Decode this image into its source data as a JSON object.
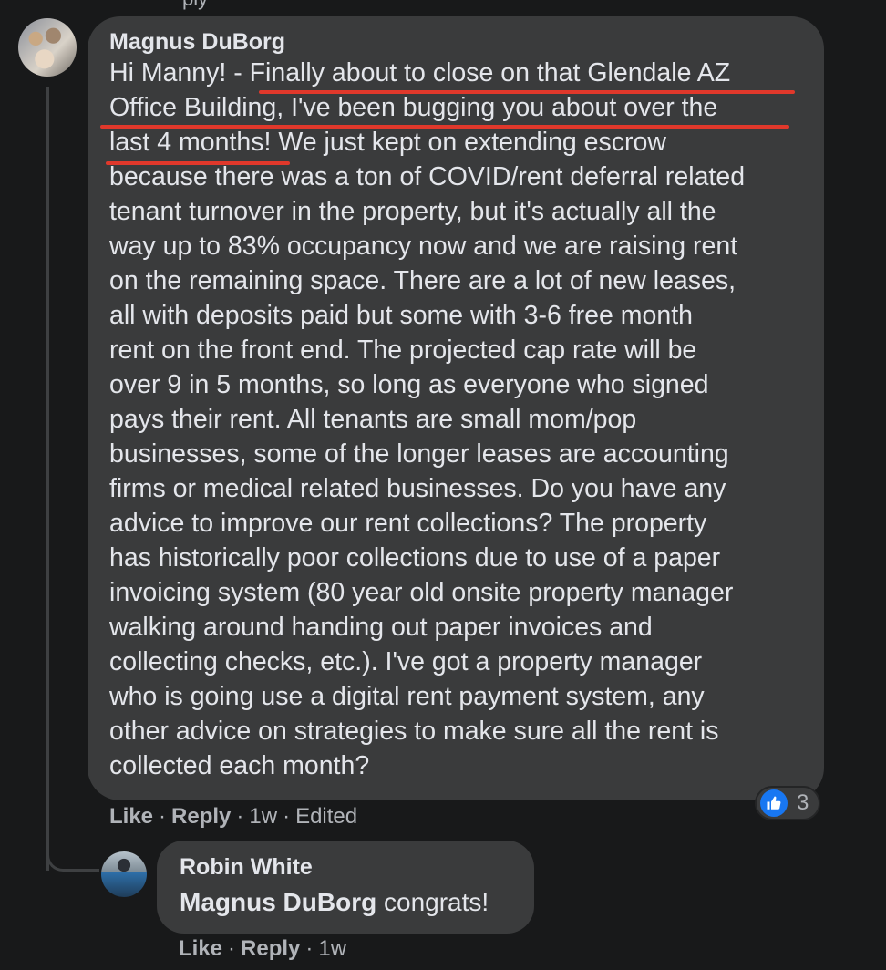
{
  "thread": {
    "above_fragment": "ply"
  },
  "comment": {
    "author": "Magnus DuBorg",
    "text": "Hi Manny! - Finally about to close on that Glendale AZ\nOffice Building, I've been bugging you about over the\nlast 4 months! We just kept on extending escrow\nbecause there was a ton of COVID/rent deferral related\ntenant turnover in the property, but it's actually all the\nway up to 83% occupancy now and we are raising rent\non the remaining space. There are a lot of new leases,\nall with deposits paid but some with 3-6 free month\nrent on the front end. The projected cap rate will be\nover 9 in 5 months, so long as everyone who signed\npays their rent. All tenants are small mom/pop\nbusinesses, some of the longer leases are accounting\nfirms or medical related businesses. Do you have any\nadvice to improve our rent collections? The property\nhas historically poor collections due to use of a paper\ninvoicing system (80 year old onsite property manager\nwalking around handing out paper invoices and\ncollecting checks, etc.). I've got a property manager\nwho is going use a digital rent payment system, any\nother advice on strategies to make sure all the rent is\ncollected each month?",
    "actions": {
      "like": "Like",
      "reply": "Reply",
      "time": "1w",
      "edited": "Edited",
      "separator": "·"
    },
    "reactions": {
      "icon": "thumbs-up-icon",
      "count": "3",
      "color": "#1877f2"
    },
    "annotation_color": "#e0382b"
  },
  "reply": {
    "author": "Robin White",
    "mention": "Magnus DuBorg",
    "text": " congrats!",
    "actions": {
      "like": "Like",
      "reply": "Reply",
      "time": "1w",
      "separator": "·"
    }
  },
  "theme": {
    "background": "#18191a",
    "bubble": "#3a3b3c",
    "text": "#e4e6eb",
    "secondary_text": "#b0b3b8"
  }
}
